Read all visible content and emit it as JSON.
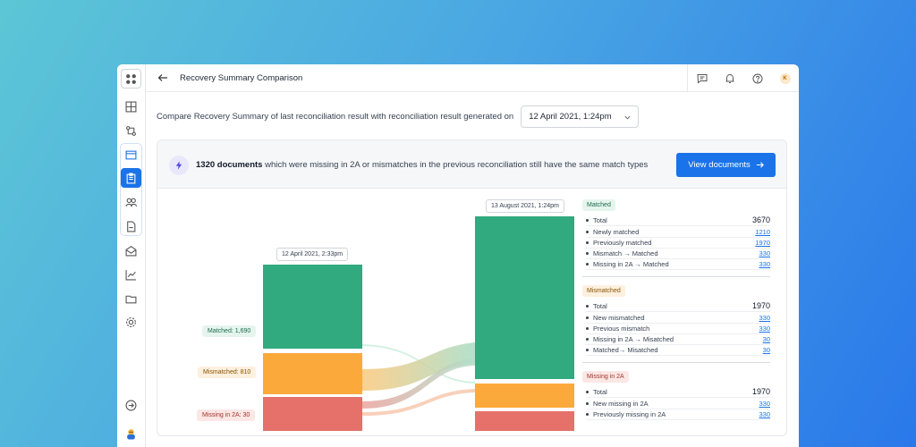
{
  "header": {
    "title": "Recovery Summary Comparison",
    "avatar_initial": "K"
  },
  "compare": {
    "text": "Compare Recovery Summary of last reconciliation result with reconciliation result generated on",
    "selected_date": "12 April 2021, 1:24pm"
  },
  "banner": {
    "count": "1320 documents",
    "text": " which were missing in 2A or mismatches in the previous reconciliation still have the same match types",
    "button_label": "View documents"
  },
  "chart": {
    "left_date": "12 April 2021, 2:33pm",
    "right_date": "13 August 2021, 1:24pm",
    "left_labels": [
      "Matched: 1,690",
      "Mismatched: 810",
      "Missing in 2A: 30"
    ],
    "colors": {
      "matched": "#31aa7f",
      "mismatched": "#fca93b",
      "missing": "#e5716a"
    }
  },
  "summary": {
    "sections": [
      {
        "tag": "Matched",
        "color": "green",
        "rows": [
          {
            "label": "Total",
            "value": "3670",
            "total": true
          },
          {
            "label": "Newly matched",
            "value": "1210"
          },
          {
            "label": "Previously matched",
            "value": "1970"
          },
          {
            "label": "Mismatch → Matched",
            "value": "330"
          },
          {
            "label": "Missing in 2A → Matched",
            "value": "330"
          }
        ]
      },
      {
        "tag": "Mismatched",
        "color": "orange",
        "rows": [
          {
            "label": "Total",
            "value": "1970",
            "total": true
          },
          {
            "label": "New mismatched",
            "value": "330"
          },
          {
            "label": "Previous mismatch",
            "value": "330"
          },
          {
            "label": "Missing in 2A → Misatched",
            "value": "30"
          },
          {
            "label": "Matched→ Misatched",
            "value": "30"
          }
        ]
      },
      {
        "tag": "Missing in 2A",
        "color": "red",
        "rows": [
          {
            "label": "Total",
            "value": "1970",
            "total": true
          },
          {
            "label": "New missing in 2A",
            "value": "330"
          },
          {
            "label": "Previously missing in 2A",
            "value": "330"
          }
        ]
      }
    ]
  }
}
